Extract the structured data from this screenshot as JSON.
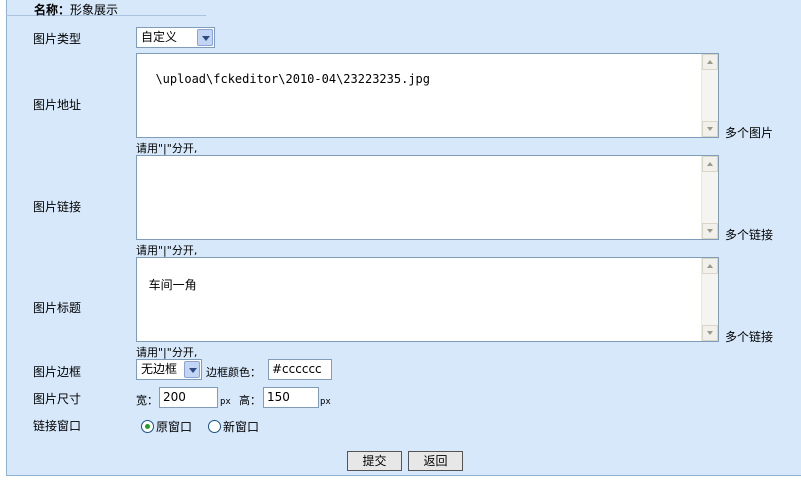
{
  "header": {
    "name_label": "名称：",
    "name_value": "形象展示"
  },
  "fields": {
    "type": {
      "label": "图片类型",
      "value": "自定义"
    },
    "url": {
      "label": "图片地址",
      "value": "\\upload\\fckeditor\\2010-04\\23223235.jpg",
      "side_note": "多个图片",
      "hint": "请用\"|\"分开,"
    },
    "link": {
      "label": "图片链接",
      "value": "",
      "side_note": "多个链接",
      "hint": "请用\"|\"分开,"
    },
    "title": {
      "label": "图片标题",
      "value": "车间一角",
      "side_note": "多个链接",
      "hint": "请用\"|\"分开,"
    },
    "border": {
      "label": "图片边框",
      "value": "无边框",
      "color_label": "边框颜色：",
      "color_value": "#cccccc"
    },
    "size": {
      "label": "图片尺寸",
      "width_label": "宽：",
      "width_value": "200",
      "height_label": "高：",
      "height_value": "150",
      "unit": "px"
    },
    "window": {
      "label": "链接窗口",
      "options": [
        "原窗口",
        "新窗口"
      ],
      "selected": "原窗口"
    }
  },
  "buttons": {
    "submit": "提交",
    "back": "返回"
  }
}
